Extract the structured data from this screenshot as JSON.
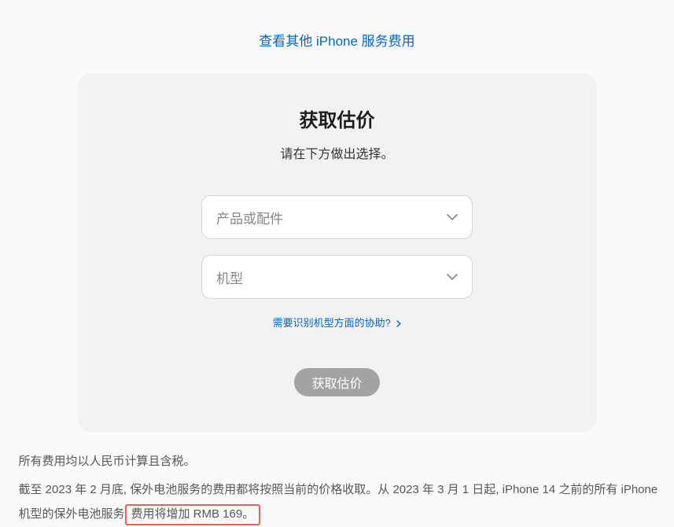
{
  "topLink": {
    "label": "查看其他 iPhone 服务费用"
  },
  "card": {
    "title": "获取估价",
    "subtitle": "请在下方做出选择。",
    "select1": {
      "placeholder": "产品或配件"
    },
    "select2": {
      "placeholder": "机型"
    },
    "helpLink": {
      "label": "需要识别机型方面的协助?"
    },
    "button": {
      "label": "获取估价"
    }
  },
  "notes": {
    "line1": "所有费用均以人民币计算且含税。",
    "line2_part1": "截至 2023 年 2 月底, 保外电池服务的费用都将按照当前的价格收取。从 2023 年 3 月 1 日起, iPhone 14 之前的所有 iPhone 机型的保外电池服务",
    "line2_highlight": "费用将增加 RMB 169。"
  }
}
